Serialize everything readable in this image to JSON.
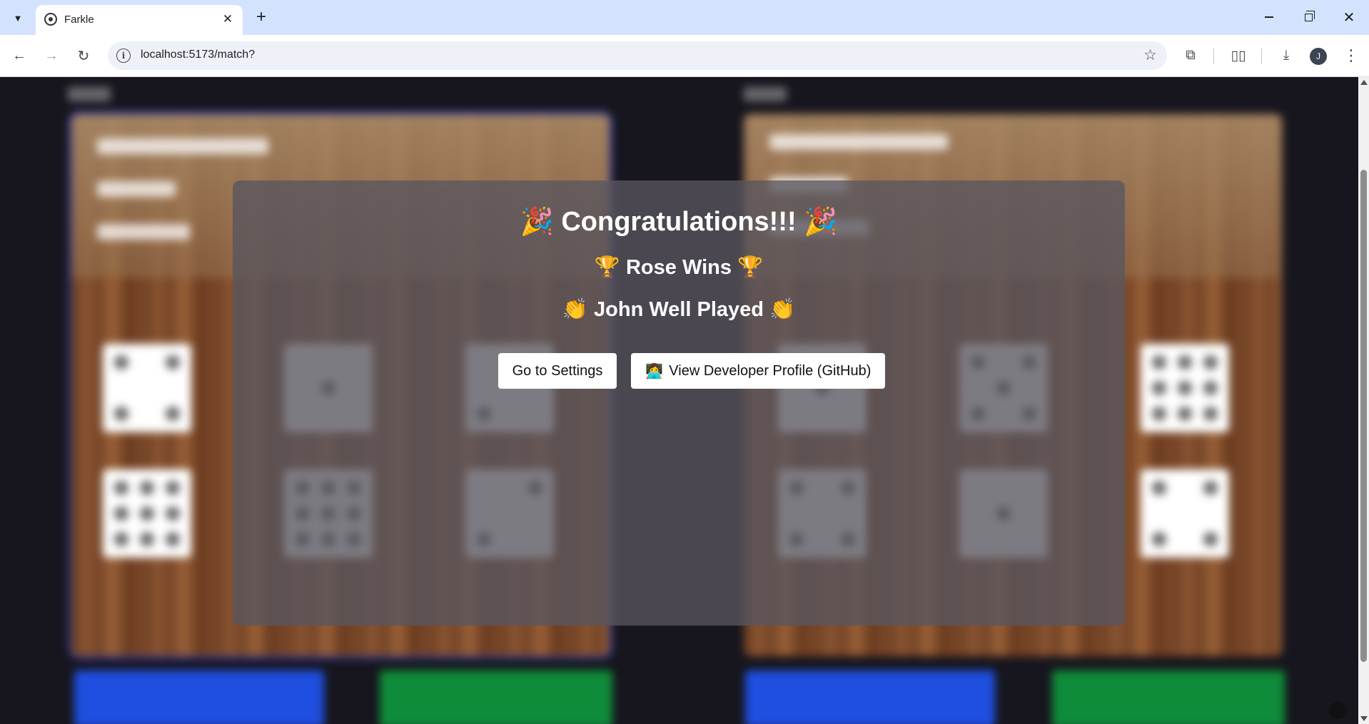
{
  "browser": {
    "tab_title": "Farkle",
    "url": "localhost:5173/match?",
    "profile_initial": "J",
    "icons": {
      "tab_list": "chevron-down-icon",
      "close_tab": "close-icon",
      "new_tab": "plus-icon",
      "back": "arrow-left-icon",
      "forward": "arrow-right-icon",
      "reload": "reload-icon",
      "site_info": "info-icon",
      "bookmark": "star-icon",
      "extensions": "puzzle-icon",
      "reading_list": "book-icon",
      "downloads": "download-icon",
      "menu": "kebab-menu-icon"
    }
  },
  "modal": {
    "congrats": "🎉 Congratulations!!! 🎉",
    "winner": "🏆 Rose Wins 🏆",
    "loser": "👏 John Well Played 👏",
    "settings_button": "Go to Settings",
    "github_emoji": "👩‍💻",
    "github_button": "View Developer Profile (GitHub)"
  },
  "colors": {
    "accent_blue": "#1f4fe0",
    "accent_green": "#0f8c3a",
    "modal_bg": "rgba(88, 86, 95, 0.78)"
  }
}
